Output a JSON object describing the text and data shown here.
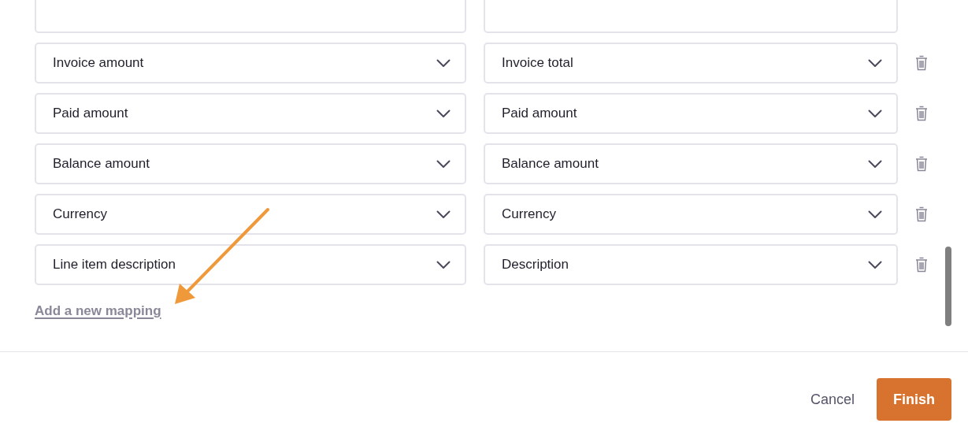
{
  "mappings": [
    {
      "source": "Invoice amount",
      "target": "Invoice total"
    },
    {
      "source": "Paid amount",
      "target": "Paid amount"
    },
    {
      "source": "Balance amount",
      "target": "Balance amount"
    },
    {
      "source": "Currency",
      "target": "Currency"
    },
    {
      "source": "Line item description",
      "target": "Description"
    }
  ],
  "add_link": "Add a new mapping",
  "buttons": [
    {
      "label": "Cancel",
      "kind": "secondary"
    },
    {
      "label": "Finish",
      "kind": "primary"
    }
  ]
}
